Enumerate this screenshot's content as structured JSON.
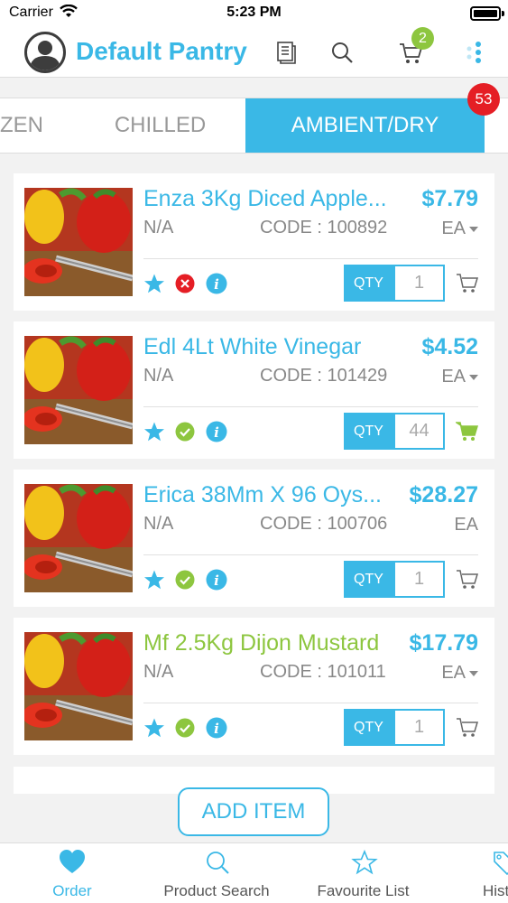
{
  "status_bar": {
    "carrier": "Carrier",
    "time": "5:23 PM"
  },
  "header": {
    "title": "Default Pantry",
    "cart_count": "2",
    "icons": [
      "avatar-icon",
      "document-icon",
      "search-icon",
      "cart-icon",
      "dots-menu-icon"
    ]
  },
  "tabs": {
    "items": [
      {
        "label": "ZEN",
        "active": false
      },
      {
        "label": "CHILLED",
        "active": false
      },
      {
        "label": "AMBIENT/DRY",
        "active": true
      }
    ],
    "badge": "53"
  },
  "colors": {
    "accent": "#3ab8e6",
    "green": "#8dc63f",
    "red": "#e51e25"
  },
  "products": [
    {
      "name": "Enza 3Kg Diced Apple...",
      "price": "$7.79",
      "sku": "N/A",
      "code": "CODE : 100892",
      "unit": "EA",
      "has_unit_dropdown": true,
      "qty_label": "QTY",
      "qty": "1",
      "status": "unavailable",
      "in_cart": false
    },
    {
      "name": "Edl 4Lt White Vinegar",
      "price": "$4.52",
      "sku": "N/A",
      "code": "CODE : 101429",
      "unit": "EA",
      "has_unit_dropdown": true,
      "qty_label": "QTY",
      "qty": "44",
      "status": "available",
      "in_cart": true
    },
    {
      "name": "Erica 38Mm X 96 Oys...",
      "price": "$28.27",
      "sku": "N/A",
      "code": "CODE : 100706",
      "unit": "EA",
      "has_unit_dropdown": false,
      "qty_label": "QTY",
      "qty": "1",
      "status": "available",
      "in_cart": false
    },
    {
      "name": "Mf 2.5Kg Dijon Mustard",
      "price": "$17.79",
      "sku": "N/A",
      "code": "CODE : 101011",
      "unit": "EA",
      "has_unit_dropdown": true,
      "qty_label": "QTY",
      "qty": "1",
      "status": "available",
      "in_cart": false,
      "name_color": "#8dc63f"
    }
  ],
  "add_item": "ADD ITEM",
  "bottom_nav": [
    {
      "label": "Order",
      "icon": "heart-icon",
      "active": true
    },
    {
      "label": "Product Search",
      "icon": "search-icon",
      "active": false
    },
    {
      "label": "Favourite List",
      "icon": "star-icon",
      "active": false
    },
    {
      "label": "Hist",
      "icon": "tag-icon",
      "active": false
    }
  ]
}
